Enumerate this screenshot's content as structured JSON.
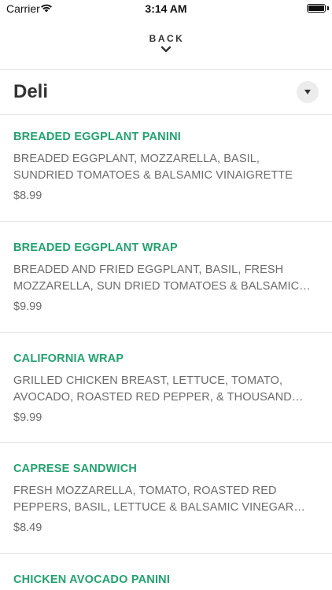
{
  "status_bar": {
    "carrier": "Carrier",
    "time": "3:14 AM"
  },
  "nav": {
    "back_label": "BACK"
  },
  "category": {
    "title": "Deli"
  },
  "colors": {
    "item_name": "#22a36f",
    "text": "#333333",
    "muted": "#6b6b6b"
  },
  "items": [
    {
      "name": "BREADED EGGPLANT PANINI",
      "description": "BREADED EGGPLANT, MOZZARELLA, BASIL, SUNDRIED TOMATOES & BALSAMIC VINAIGRETTE",
      "price": "$8.99"
    },
    {
      "name": "BREADED EGGPLANT WRAP",
      "description": "BREADED AND FRIED EGGPLANT, BASIL, FRESH MOZZARELLA, SUN DRIED TOMATOES & BALSAMIC…",
      "price": "$9.99"
    },
    {
      "name": "CALIFORNIA WRAP",
      "description": "GRILLED CHICKEN BREAST, LETTUCE, TOMATO, AVOCADO, ROASTED RED PEPPER, & THOUSAND ISL…",
      "price": "$9.99"
    },
    {
      "name": "CAPRESE SANDWICH",
      "description": "FRESH MOZZARELLA, TOMATO, ROASTED RED PEPPERS, BASIL, LETTUCE & BALSAMIC VINEGAR ON…",
      "price": "$8.49"
    },
    {
      "name": "CHICKEN AVOCADO PANINI",
      "description": "",
      "price": ""
    }
  ]
}
